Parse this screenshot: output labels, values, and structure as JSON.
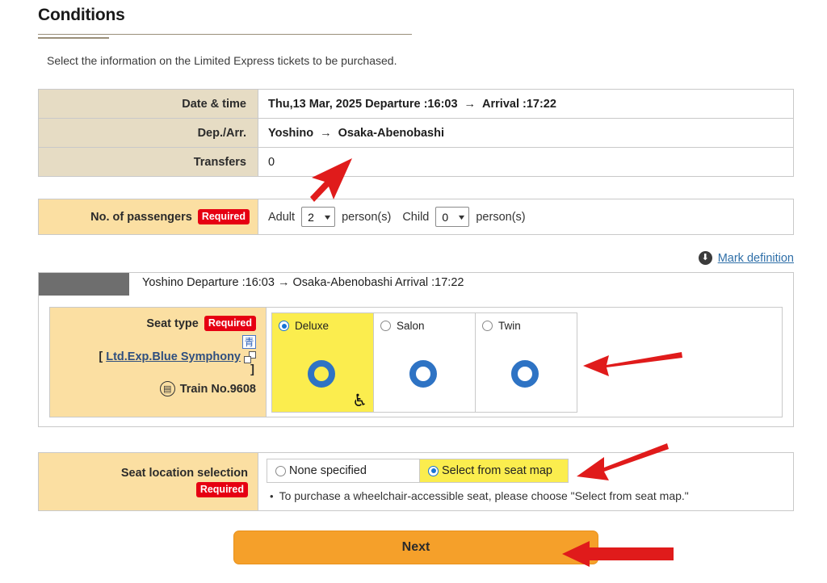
{
  "page": {
    "heading": "Conditions",
    "lede": "Select the information on the Limited Express tickets to be purchased."
  },
  "summary": {
    "rows": [
      {
        "label": "Date & time",
        "value": "Thu,13 Mar, 2025 Departure :16:03",
        "arrow": "→",
        "value2": "Arrival :17:22"
      },
      {
        "label": "Dep./Arr.",
        "value": "Yoshino",
        "arrow": "→",
        "value2": "Osaka-Abenobashi"
      },
      {
        "label": "Transfers",
        "value": "0",
        "arrow": "",
        "value2": ""
      }
    ]
  },
  "passengers": {
    "label": "No. of passengers",
    "required": "Required",
    "adult_label": "Adult",
    "adult_value": "2",
    "adult_unit": "person(s)",
    "child_label": "Child",
    "child_value": "0",
    "child_unit": "person(s)",
    "chevron": "▼"
  },
  "mark_definition": {
    "icon": "download-circle-icon",
    "glyph": "⬇",
    "label": "Mark definition"
  },
  "seat_panel": {
    "route": "Yoshino   Departure :16:03    →   Osaka-Abenobashi   Arrival :17:22",
    "label": "Seat type",
    "required": "Required",
    "kanji_icon": "青",
    "bracket_open": "[",
    "train_link": "Ltd.Exp.Blue Symphony",
    "bracket_close": "]",
    "train_no_icon": "▤",
    "train_no": "Train No.9608",
    "options": [
      {
        "name": "Deluxe",
        "selected": true,
        "mark": "circle-available",
        "wheelchair": "♿"
      },
      {
        "name": "Salon",
        "selected": false,
        "mark": "circle-available",
        "wheelchair": ""
      },
      {
        "name": "Twin",
        "selected": false,
        "mark": "circle-available",
        "wheelchair": ""
      }
    ]
  },
  "seat_location": {
    "label": "Seat location selection",
    "required": "Required",
    "choices": [
      {
        "label": "None specified",
        "selected": false
      },
      {
        "label": "Select from seat map",
        "selected": true
      }
    ],
    "note_bullet": "•",
    "note": "To purchase a wheelchair-accessible seat, please choose \"Select from seat map.\""
  },
  "footer": {
    "next_label": "Next"
  },
  "colors": {
    "required_badge": "#e60012",
    "header_cell": "#e6dcc4",
    "highlight_cell": "#fbdfa2",
    "selected_yellow": "#fbed4e",
    "next_button": "#f5a02a",
    "mark_blue": "#2e73c4",
    "annotation_red": "#e01b1b"
  }
}
